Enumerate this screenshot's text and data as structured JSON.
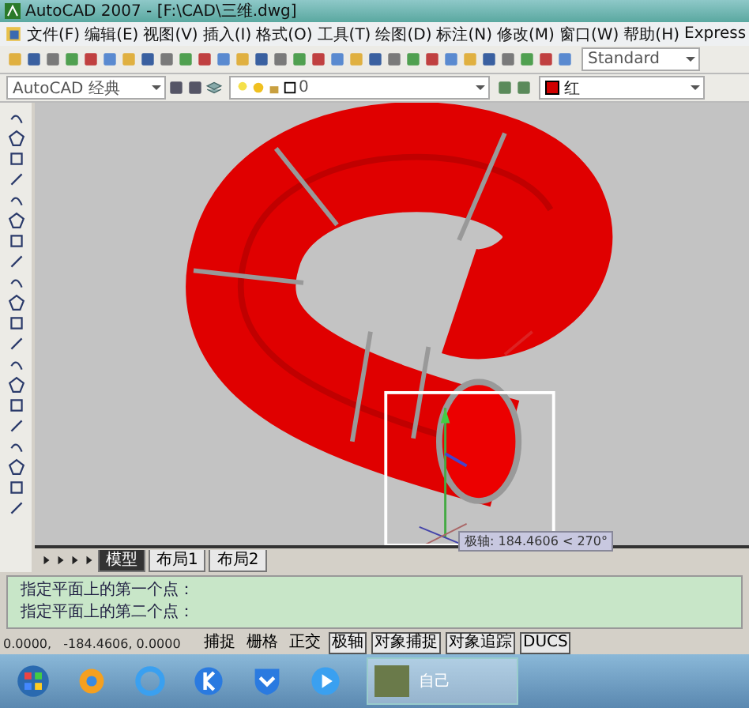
{
  "window": {
    "title": "AutoCAD 2007 - [F:\\CAD\\三维.dwg]"
  },
  "menu": [
    "文件(F)",
    "编辑(E)",
    "视图(V)",
    "插入(I)",
    "格式(O)",
    "工具(T)",
    "绘图(D)",
    "标注(N)",
    "修改(M)",
    "窗口(W)",
    "帮助(H)",
    "Express"
  ],
  "toolbars": {
    "text_style": "Standard",
    "workspace": "AutoCAD 经典",
    "layer": "0",
    "color_name": "红"
  },
  "tooltip": "极轴: 184.4606 < 270°",
  "layout_tabs": [
    {
      "label": "模型",
      "selected": true
    },
    {
      "label": "布局1",
      "selected": false
    },
    {
      "label": "布局2",
      "selected": false
    }
  ],
  "command_lines": [
    "指定平面上的第一个点：",
    "指定平面上的第二个点："
  ],
  "status": {
    "coordinates": "0.0000,   -184.4606, 0.0000",
    "toggles": [
      {
        "label": "捕捉",
        "on": false
      },
      {
        "label": "栅格",
        "on": false
      },
      {
        "label": "正交",
        "on": false
      },
      {
        "label": "极轴",
        "on": true
      },
      {
        "label": "对象捕捉",
        "on": true
      },
      {
        "label": "对象追踪",
        "on": true
      },
      {
        "label": "DUCS",
        "on": true
      }
    ]
  },
  "taskbar": {
    "window_label": "自己"
  }
}
